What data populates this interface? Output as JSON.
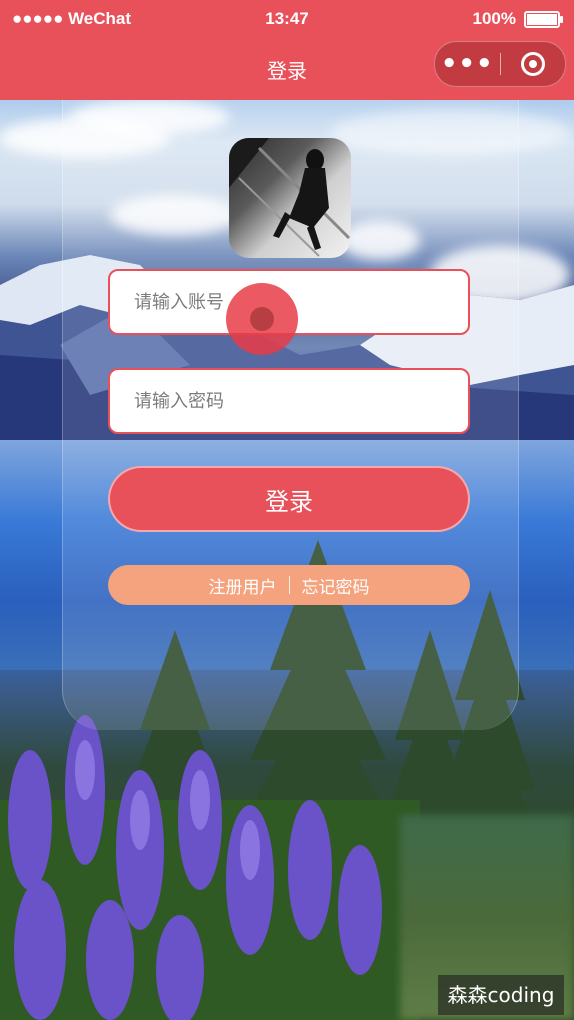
{
  "status_bar": {
    "carrier": "●●●●● WeChat",
    "time": "13:47",
    "battery_percent": "100%"
  },
  "nav": {
    "title": "登录",
    "more_label": "•••"
  },
  "form": {
    "account_placeholder": "请输入账号",
    "password_placeholder": "请输入密码",
    "login_label": "登录"
  },
  "links": {
    "register": "注册用户",
    "forgot": "忘记密码"
  },
  "watermark": "森森coding",
  "colors": {
    "accent": "#e8515a",
    "links_bar": "#f4a37e"
  }
}
